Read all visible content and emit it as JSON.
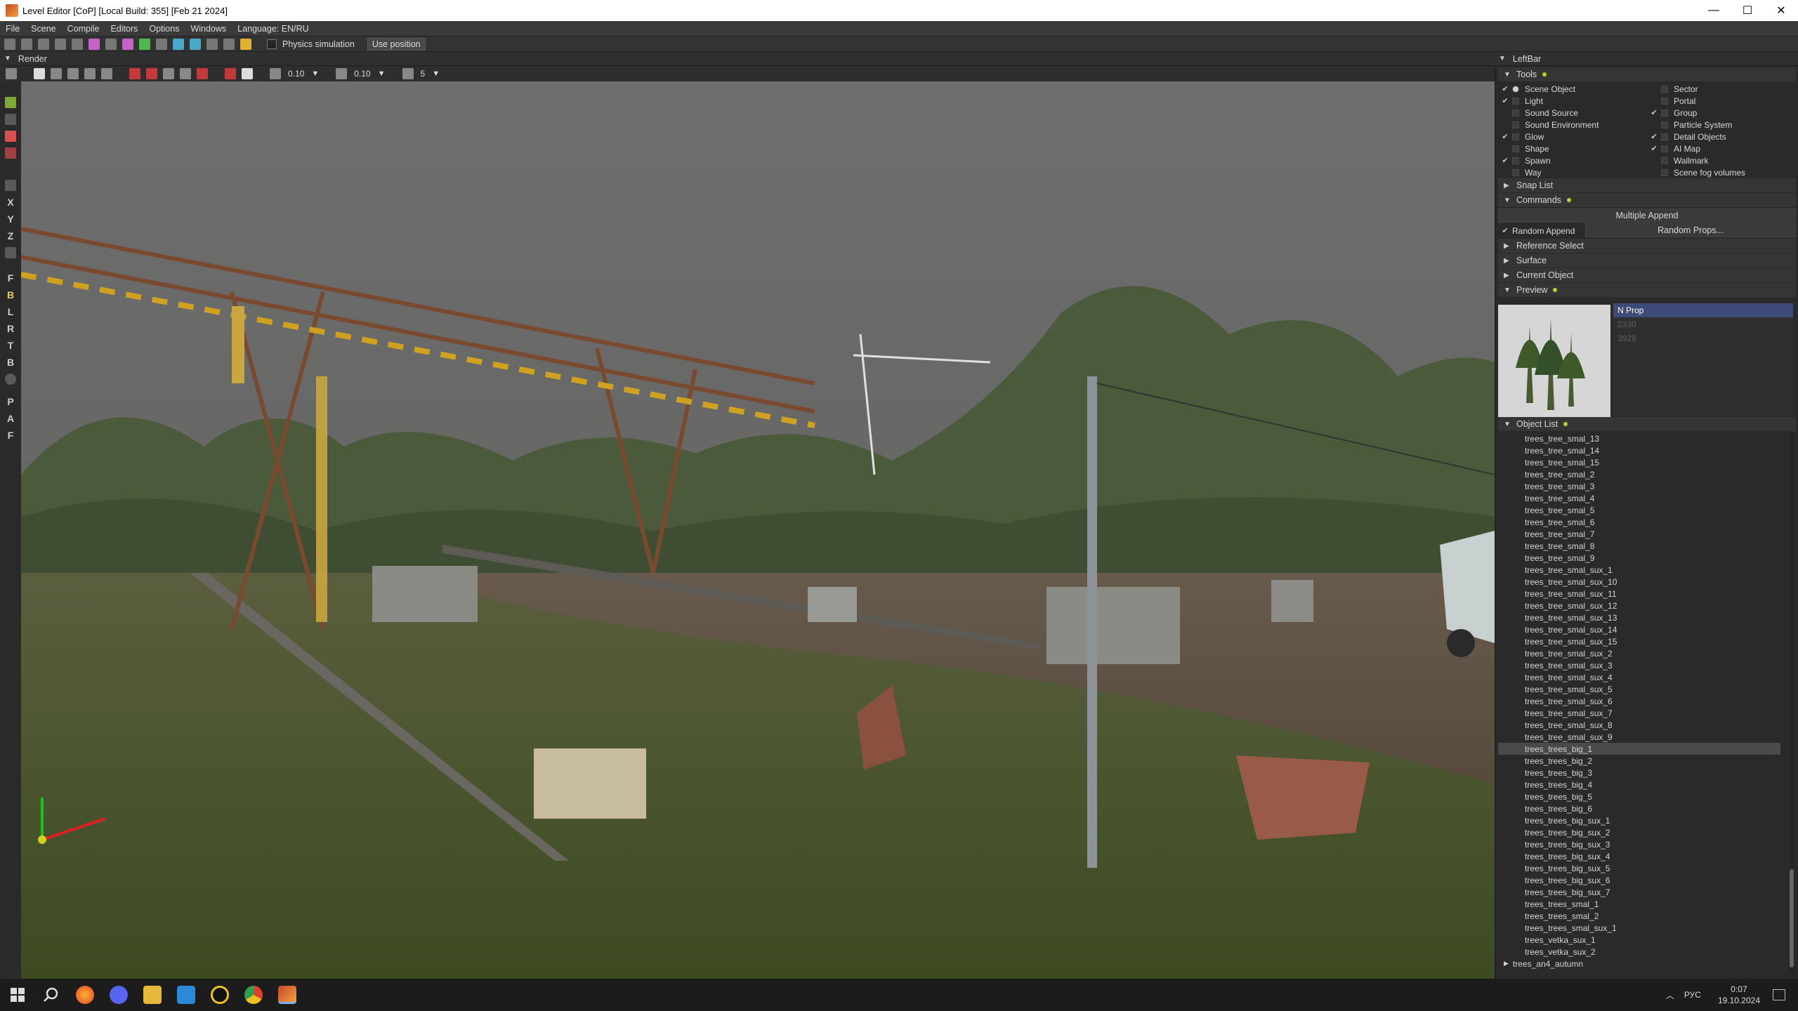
{
  "window": {
    "title": "Level Editor [CoP] [Local Build: 355] [Feb 21 2024]",
    "minimize": "—",
    "maximize": "☐",
    "close": "✕"
  },
  "menu": [
    "File",
    "Scene",
    "Compile",
    "Editors",
    "Options",
    "Windows",
    "Language: EN/RU"
  ],
  "toolbar": {
    "physics_label": "Physics simulation",
    "use_position_label": "Use position"
  },
  "render": {
    "header": "Render",
    "grid_value": "0.10",
    "scale_value": "0.10",
    "angle_value": "5"
  },
  "vertical_toolbar": [
    "X",
    "Y",
    "Z",
    "F",
    "B",
    "L",
    "R",
    "T",
    "B",
    "P",
    "A",
    "F"
  ],
  "leftbar": {
    "header": "LeftBar",
    "tools_label": "Tools",
    "tools_left": [
      {
        "label": "Scene Object",
        "checked": true
      },
      {
        "label": "Light",
        "checked": true
      },
      {
        "label": "Sound Source",
        "checked": false
      },
      {
        "label": "Sound Environment",
        "checked": false
      },
      {
        "label": "Glow",
        "checked": true
      },
      {
        "label": "Shape",
        "checked": false
      },
      {
        "label": "Spawn",
        "checked": true
      },
      {
        "label": "Way",
        "checked": false
      }
    ],
    "tools_right": [
      {
        "label": "Sector",
        "checked": false
      },
      {
        "label": "Portal",
        "checked": false
      },
      {
        "label": "Group",
        "checked": true
      },
      {
        "label": "Particle System",
        "checked": false
      },
      {
        "label": "Detail Objects",
        "checked": true
      },
      {
        "label": "AI Map",
        "checked": true
      },
      {
        "label": "Wallmark",
        "checked": false
      },
      {
        "label": "Scene fog volumes",
        "checked": false
      }
    ],
    "snap_list_label": "Snap List",
    "commands_label": "Commands",
    "multiple_append_label": "Multiple Append",
    "random_append_label": "Random Append",
    "random_props_label": "Random Props...",
    "reference_select_label": "Reference Select",
    "surface_label": "Surface",
    "current_object_label": "Current Object",
    "preview_label": "Preview",
    "preview_list": [
      "N Prop",
      "2330",
      "3928"
    ],
    "object_list_label": "Object List",
    "objects": [
      "trees_tree_smal_13",
      "trees_tree_smal_14",
      "trees_tree_smal_15",
      "trees_tree_smal_2",
      "trees_tree_smal_3",
      "trees_tree_smal_4",
      "trees_tree_smal_5",
      "trees_tree_smal_6",
      "trees_tree_smal_7",
      "trees_tree_smal_8",
      "trees_tree_smal_9",
      "trees_tree_smal_sux_1",
      "trees_tree_smal_sux_10",
      "trees_tree_smal_sux_11",
      "trees_tree_smal_sux_12",
      "trees_tree_smal_sux_13",
      "trees_tree_smal_sux_14",
      "trees_tree_smal_sux_15",
      "trees_tree_smal_sux_2",
      "trees_tree_smal_sux_3",
      "trees_tree_smal_sux_4",
      "trees_tree_smal_sux_5",
      "trees_tree_smal_sux_6",
      "trees_tree_smal_sux_7",
      "trees_tree_smal_sux_8",
      "trees_tree_smal_sux_9",
      "trees_trees_big_1",
      "trees_trees_big_2",
      "trees_trees_big_3",
      "trees_trees_big_4",
      "trees_trees_big_5",
      "trees_trees_big_6",
      "trees_trees_big_sux_1",
      "trees_trees_big_sux_2",
      "trees_trees_big_sux_3",
      "trees_trees_big_sux_4",
      "trees_trees_big_sux_5",
      "trees_trees_big_sux_6",
      "trees_trees_big_sux_7",
      "trees_trees_smal_1",
      "trees_trees_smal_2",
      "trees_trees_smal_sux_1",
      "trees_vetka_sux_1",
      "trees_vetka_sux_2"
    ],
    "selected_object": "trees_trees_big_1",
    "next_group": "trees_an4_autumn"
  },
  "taskbar": {
    "lang": "РУС",
    "time": "0:07",
    "date": "19.10.2024"
  }
}
